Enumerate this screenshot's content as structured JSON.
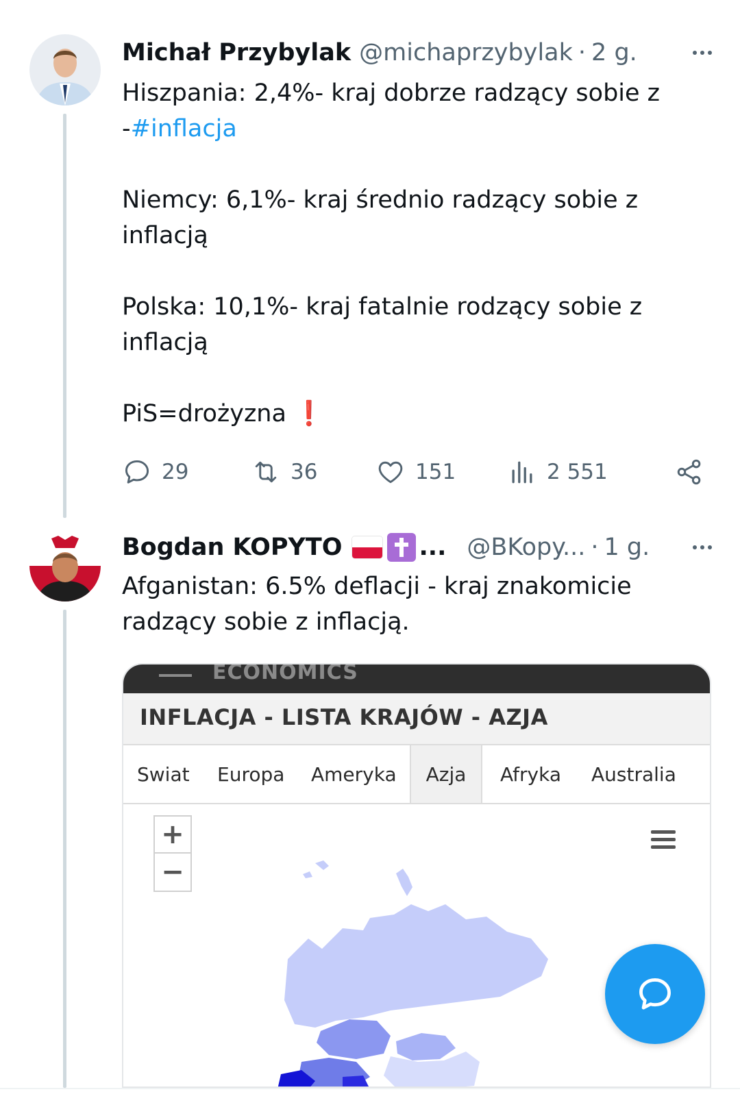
{
  "tweets": [
    {
      "author_name": "Michał Przybylak",
      "handle": "@michaprzybylak",
      "separator": "·",
      "time": "2 g.",
      "text": {
        "line1": "Hiszpania: 2,4%- kraj dobrze radzący sobie z",
        "line2_prefix": "-",
        "hashtag": "#inflacja",
        "p2": "Niemcy: 6,1%- kraj średnio radzący sobie z inflacją",
        "p3": "Polska: 10,1%- kraj fatalnie rodzący sobie z inflacją",
        "p4": "PiS=drożyzna",
        "p4_emoji": "❗"
      },
      "stats": {
        "replies": "29",
        "retweets": "36",
        "likes": "151",
        "views": "2 551"
      }
    },
    {
      "author_name": "Bogdan KOPYTO",
      "name_ellipsis": "...",
      "handle": "@BKopy...",
      "separator": "·",
      "time": "1 g.",
      "text": "Afganistan: 6.5% deflacji - kraj znakomicie radzący sobie z inflacją."
    }
  ],
  "card": {
    "brand": "ECONOMICS",
    "title": "INFLACJA - LISTA KRAJÓW - AZJA",
    "tabs": [
      "Swiat",
      "Europa",
      "Ameryka",
      "Azja",
      "Afryka",
      "Australia"
    ],
    "active_tab": "Azja",
    "zoom_in": "+",
    "zoom_out": "−"
  },
  "colors": {
    "accent": "#1d9bf0",
    "text_secondary": "#536471",
    "map_light": "#c5cdfa",
    "map_mid": "#8b97f0",
    "map_dark": "#1414d6"
  },
  "icons": {
    "reply": "speech-bubble-icon",
    "retweet": "retweet-icon",
    "like": "heart-icon",
    "views": "bar-chart-icon",
    "share": "share-icon",
    "fab": "compose-reply-icon"
  }
}
